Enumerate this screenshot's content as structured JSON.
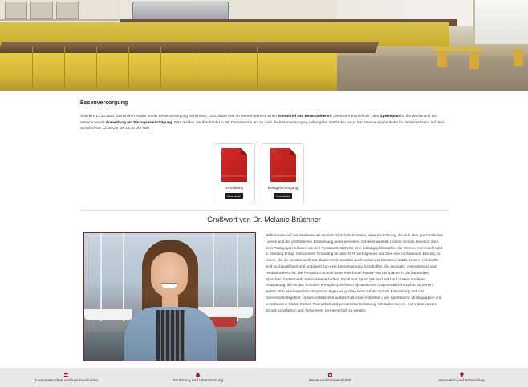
{
  "hero": {
    "image": "cafeteria-kitchen"
  },
  "section": {
    "title": "Essenversorgung",
    "intro_parts": [
      "Seit dem 17.10.2022 können Ihre Kinder an der Essenversorgung teilnehmen. Dazu finden Sie im unteren Bereich einen ",
      "Elternbrief des Essenanbieters",
      " „Ivenacker Kinnerköök“, den ",
      "Speiseplan",
      " für die Woche und die entsprechende ",
      "Anmeldung mit Einzugsermächtigung",
      ". Bitte melden Sie Ihre Kinder in der Ferienwoche an, so dass die Essenversorgung reibungslos stattfinden kann. Die Essenausgabe findet im Imbisscontainer auf dem Schulhof von 11.00 Uhr bis 13.00 Uhr statt"
    ]
  },
  "downloads": [
    {
      "label": "Anmeldung",
      "button": "Download",
      "icon": "pdf-document-icon"
    },
    {
      "label": "Mittagsversorgung",
      "button": "Download",
      "icon": "pdf-document-icon"
    }
  ],
  "greeting": {
    "title": "Grußwort von Dr. Melanie Brüchner",
    "text": "Willkommen auf der Webseite der Pestalozzi-Schule Demmin, einer Einrichtung, die sich dem ganzheitlichen Lernen und der persönlichen Entwicklung jedes einzelnen Schülers widmet. Unsere Schule, benannt nach dem Pädagogen Johann Heinrich Pestalozzi, steht für eine Bildungsphilosophie, die Wissen, Herz und Hand in Einklang bringt. Seit unserer Gründung im Jahr 1975 verfolgen wir das Ziel, eine umfassende Bildung zu bieten, die die Schüler nicht nur akademisch, sondern auch sozial und emotional stärkt. Unsere Lehrkräfte sind hochqualifiziert und engagiert, um eine Lernumgebung zu schaffen, die innovativ, unterstützend und herausfordernd ist. Die Pestalozzi-Schule bietet eine breite Palette von Lehrplänen in den Bereichen Sprachen, Mathematik, Naturwissenschaften, Kunst und Sport. Wir sind stolz auf unsere moderne Ausstattung, die es den Schülern ermöglicht, in einem dynamischen und interaktiven Umfeld zu lernen. Neben dem akademischen Programm legen wir großen Wert auf die soziale Entwicklung und das Gemeinschaftsgefühl. Unsere zahlreichen außerschulischen Aktivitäten, wie Sportteams, Musikgruppen und verschiedene Clubs, fördern Teamarbeit und persönliche Entfaltung. Wir laden Sie ein, mehr über unsere Schule zu erfahren und Teil unserer Gemeinschaft zu werden."
  },
  "footer": {
    "items": [
      {
        "label": "Zusammenarbeit und Kommunikation",
        "icon": "users-icon"
      },
      {
        "label": "Förderung und Unterstützung",
        "icon": "drop-icon"
      },
      {
        "label": "Werte und Gemeinschaft",
        "icon": "house-heart-icon"
      },
      {
        "label": "Innovation und Entwicklung",
        "icon": "lightbulb-icon"
      }
    ]
  },
  "colors": {
    "accent": "#8b1c2c",
    "pdf_red": "#c62828",
    "footer_bg": "#e8e8e8"
  }
}
